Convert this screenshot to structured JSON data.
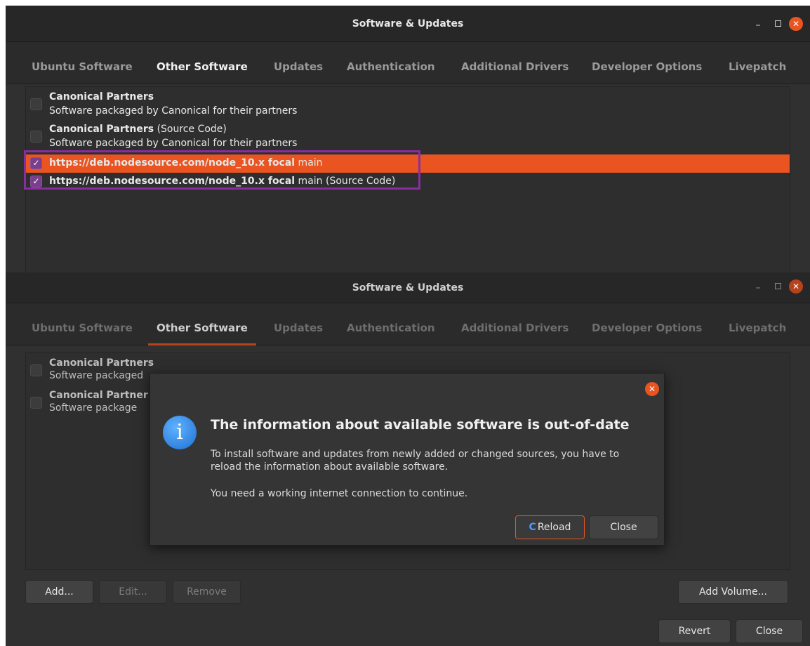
{
  "window": {
    "title": "Software & Updates",
    "tabs": [
      "Ubuntu Software",
      "Other Software",
      "Updates",
      "Authentication",
      "Additional Drivers",
      "Developer Options",
      "Livepatch"
    ],
    "active_tab": "Other Software"
  },
  "sources": {
    "items": [
      {
        "name": "Canonical Partners",
        "suffix": "",
        "desc": "Software packaged by Canonical for their partners",
        "checked": false
      },
      {
        "name": "Canonical Partners",
        "suffix": " (Source Code)",
        "desc": "Software packaged by Canonical for their partners",
        "checked": false
      },
      {
        "name": "https://deb.nodesource.com/node_10.x focal",
        "suffix": " main",
        "desc": "",
        "checked": true
      },
      {
        "name": "https://deb.nodesource.com/node_10.x focal",
        "suffix": " main (Source Code)",
        "desc": "",
        "checked": true
      }
    ],
    "truncated": [
      {
        "name": "Canonical Partners",
        "desc": "Software packaged"
      },
      {
        "name": "Canonical Partner",
        "desc": "Software package"
      }
    ]
  },
  "buttons": {
    "add": "Add...",
    "edit": "Edit...",
    "remove": "Remove",
    "add_volume": "Add Volume...",
    "revert": "Revert",
    "close": "Close"
  },
  "dialog": {
    "heading": "The information about available software is out-of-date",
    "body": "To install software and updates from newly added or changed sources, you have to reload the information about available software.",
    "note": "You need a working internet connection to continue.",
    "reload": "Reload",
    "close": "Close"
  },
  "colors": {
    "accent": "#e95420",
    "checkbox": "#7b3e8b",
    "highlight_border": "#8a2da0",
    "info": "#1f6fd1"
  },
  "icons": [
    "minimize-icon",
    "maximize-icon",
    "close-icon",
    "checkmark-icon",
    "info-icon",
    "reload-icon"
  ]
}
